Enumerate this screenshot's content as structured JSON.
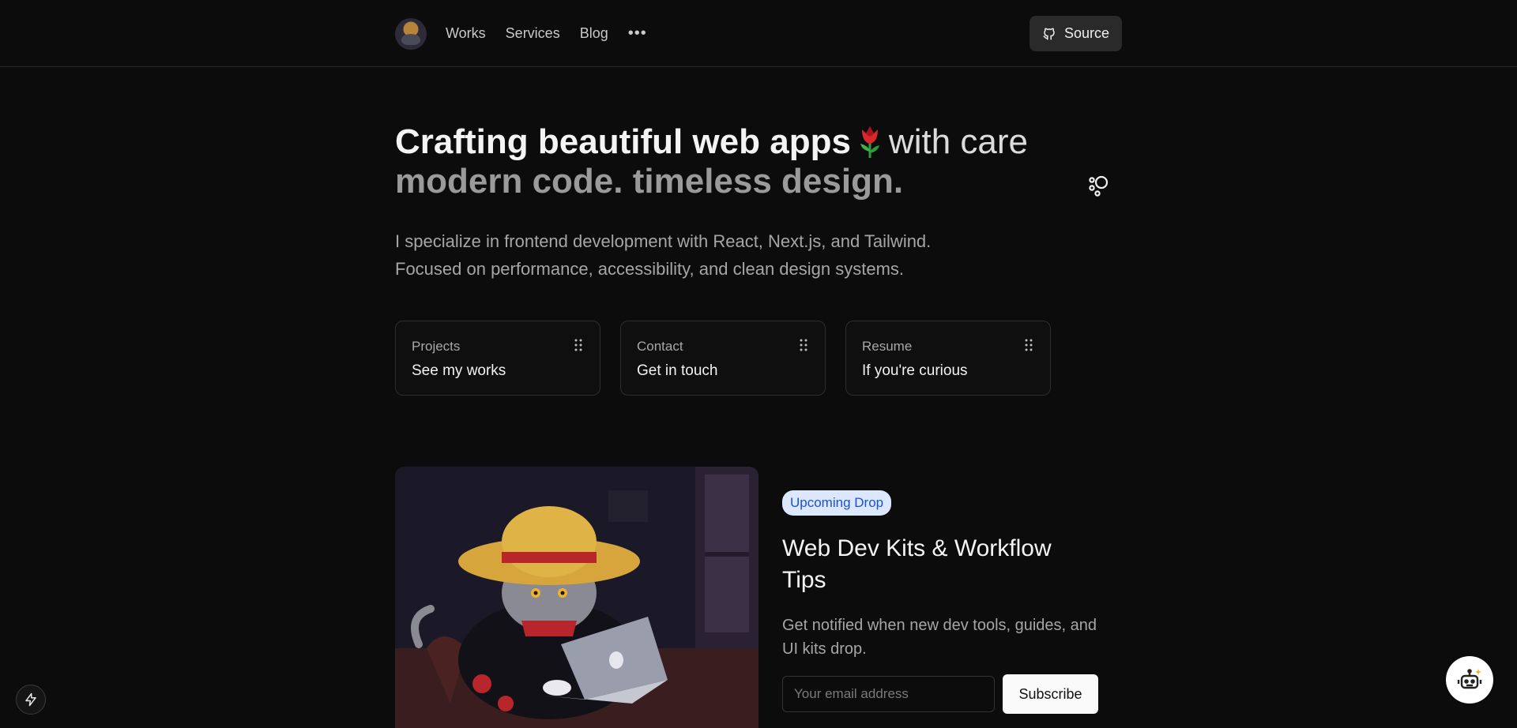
{
  "nav": {
    "links": [
      "Works",
      "Services",
      "Blog"
    ],
    "more": "•••",
    "source_label": "Source"
  },
  "hero": {
    "headline_bold": "Crafting beautiful web apps",
    "headline_light": "with care",
    "subhead": "modern code. timeless design.",
    "intro_line1": "I specialize in frontend development with React, Next.js, and Tailwind.",
    "intro_line2": "Focused on performance, accessibility, and clean design systems."
  },
  "cards": [
    {
      "label": "Projects",
      "title": "See my works"
    },
    {
      "label": "Contact",
      "title": "Get in touch"
    },
    {
      "label": "Resume",
      "title": "If you're curious"
    }
  ],
  "feature": {
    "badge": "Upcoming Drop",
    "title": "Web Dev Kits & Workflow Tips",
    "description": "Get notified when new dev tools, guides, and UI kits drop.",
    "email_placeholder": "Your email address",
    "subscribe_label": "Subscribe"
  },
  "colors": {
    "background": "#0c0c0c",
    "badge_bg": "#dbe8ff",
    "badge_text": "#1d4ed8"
  }
}
